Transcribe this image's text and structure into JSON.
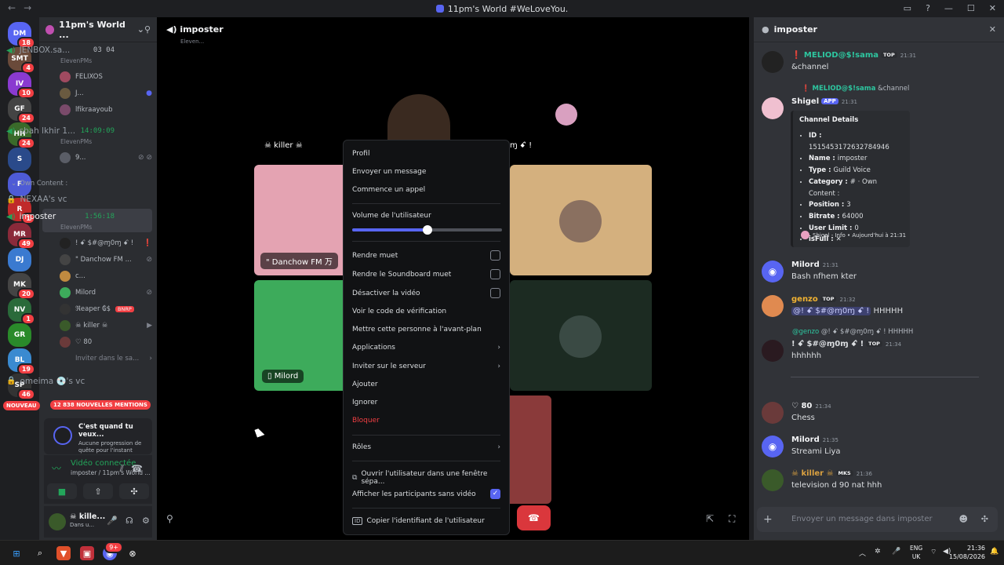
{
  "window": {
    "title": "11pm's World #WeLoveYou.",
    "back": "←",
    "forward": "→"
  },
  "guilds": [
    {
      "badge": "18",
      "label": "DM"
    },
    {
      "badge": "4",
      "label": "SMT"
    },
    {
      "badge": "10",
      "label": "IV"
    },
    {
      "badge": "24",
      "label": "GF"
    },
    {
      "badge": "24",
      "label": "HH"
    },
    {
      "badge": "",
      "label": "S"
    },
    {
      "badge": "",
      "label": "F"
    },
    {
      "badge": "1",
      "label": "R"
    },
    {
      "badge": "49",
      "label": "MR"
    },
    {
      "badge": "",
      "label": "DJ"
    },
    {
      "badge": "20",
      "label": "MK"
    },
    {
      "badge": "1",
      "label": "NV"
    },
    {
      "badge": "",
      "label": "GR"
    },
    {
      "badge": "19",
      "label": "BL"
    },
    {
      "badge": "46",
      "label": "SP"
    }
  ],
  "server": {
    "name": "11pm's World ...",
    "channels": [
      {
        "name": "JENBOX.sa...",
        "sub": "ElevenPMs",
        "time": "03 04"
      },
      {
        "name": "sbah lkhir 1...",
        "sub": "ElevenPMs",
        "time": "14:09:09"
      }
    ],
    "jenbox_members": [
      "FELIXOS",
      "J...",
      "lfikraayoub"
    ],
    "sbah_members": [
      "9..."
    ],
    "category": "Own Content :",
    "locked_channel": "NEXAA's vc",
    "active_channel": {
      "name": "imposter",
      "sub": "ElevenPMs",
      "time": "1:56:18"
    },
    "imposter_members": [
      "! ꗃ $#@ɱ0ɱ ꗃ !",
      "\" Danchow FM ...",
      "c...",
      "Milord",
      "ℜeaper ₲$",
      "☠ killer ☠",
      "♡ 80"
    ],
    "imposter_tags": {
      "bnrp": "BNRP"
    },
    "invite_label": "Inviter dans le sa...",
    "omeima_channel": "omeima 💿's vc",
    "new_label": "NOUVEAU",
    "mentions_label": "12 838 NOUVELLES MENTIONS"
  },
  "quest": {
    "title": "C'est quand tu veux...",
    "subtitle": "Aucune progression de quête pour l'instant"
  },
  "voice": {
    "status": "Vidéo connectée",
    "location": "imposter / 11pm's World ..."
  },
  "user": {
    "name": "☠ kille...",
    "status": "Dans u..."
  },
  "stage": {
    "channel": "imposter",
    "sub": "Eleven...",
    "killer_label": "☠ killer ☠",
    "danchow_label": "\" Danchow FM 万",
    "milord_label": "Milord",
    "right_label": "ɱ ꗃ !",
    "colors": {
      "pink": "#e4a3b2",
      "tan": "#d4b07e",
      "green": "#3dab5b",
      "dark": "#1c2b22",
      "red": "#8a3a3a"
    }
  },
  "context_menu": {
    "items": {
      "profile": "Profil",
      "message": "Envoyer un message",
      "call": "Commence un appel",
      "volume": "Volume de l'utilisateur",
      "mute": "Rendre muet",
      "soundboard": "Rendre le Soundboard muet",
      "video": "Désactiver la vidéo",
      "verify": "Voir le code de vérification",
      "spotlight": "Mettre cette personne à l'avant-plan",
      "apps": "Applications",
      "invite": "Inviter sur le serveur",
      "add": "Ajouter",
      "ignore": "Ignorer",
      "block": "Bloquer",
      "roles": "Rôles",
      "popout": "Ouvrir l'utilisateur dans une fenêtre sépa...",
      "show_nonvideo": "Afficher les participants sans vidéo",
      "copy_id": "Copier l'identifiant de l'utilisateur"
    },
    "volume_level": 0.5,
    "show_nonvideo_checked": true
  },
  "chat": {
    "title": "imposter",
    "messages": [
      {
        "author": "❗ MELIOD@$!sama",
        "tag": "TOP",
        "time": "21:31",
        "text": "&channel"
      },
      {
        "author": "Shigel",
        "tag": "APP",
        "time": "21:31",
        "reply": "❗ MELIOD@$!sama",
        "reply_text": "&channel"
      },
      {
        "author": "Milord",
        "time": "21:31",
        "text": "Bash nfhem kter"
      },
      {
        "author": "genzo",
        "tag": "TOP",
        "time": "21:32",
        "mention": "@! ꗃ $#@ɱ0ɱ ꗃ !",
        "text": "HHHHH"
      },
      {
        "author": "! ꗃ $#@ɱ0ɱ ꗃ !",
        "tag": "TOP",
        "time": "21:34",
        "reply": "@genzo",
        "reply_text": "@! ꗃ $#@ɱ0ɱ ꗃ ! HHHHH",
        "text": "hhhhhh"
      },
      {
        "author": "♡ 80",
        "time": "21:34",
        "text": "Chess"
      },
      {
        "author": "Milord",
        "time": "21:35",
        "text": "Streami Liya"
      },
      {
        "author": "☠ killer ☠",
        "tag": "MKS",
        "time": "21:36",
        "text": "television d 90 nat hhh"
      }
    ],
    "embed": {
      "title": "Channel Details",
      "fields": [
        {
          "k": "ID :",
          "v": "1515453172632784946"
        },
        {
          "k": "Name :",
          "v": "imposter"
        },
        {
          "k": "Type :",
          "v": "Guild Voice"
        },
        {
          "k": "Category :",
          "v": "# · Own Content :"
        },
        {
          "k": "Position :",
          "v": "3"
        },
        {
          "k": "Bitrate :",
          "v": "64000"
        },
        {
          "k": "User Limit :",
          "v": "0"
        },
        {
          "k": "isFull :",
          "v": "✕"
        }
      ],
      "footer": "Shigel - Info • Aujourd'hui à 21:31"
    },
    "placeholder": "Envoyer un message dans imposter"
  },
  "taskbar": {
    "lang": "ENG",
    "region": "UK",
    "time": "21:36",
    "date": "15/08/2026",
    "discord_badge": "9+"
  }
}
